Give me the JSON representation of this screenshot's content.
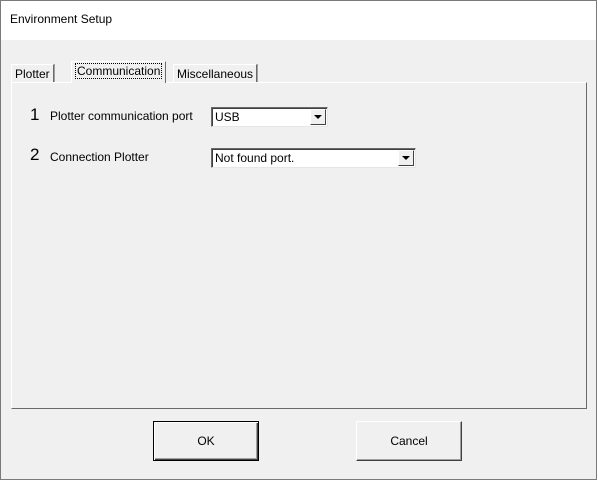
{
  "window": {
    "title": "Environment Setup"
  },
  "tabs": [
    {
      "label": "Plotter",
      "active": false
    },
    {
      "label": "Communication",
      "active": true
    },
    {
      "label": "Miscellaneous",
      "active": false
    }
  ],
  "fields": [
    {
      "number": "1",
      "label": "Plotter communication port",
      "value": "USB"
    },
    {
      "number": "2",
      "label": "Connection Plotter",
      "value": "Not found port."
    }
  ],
  "buttons": {
    "ok_label": "OK",
    "cancel_label": "Cancel"
  },
  "icons": {
    "dropdown": "chevron-down-icon"
  }
}
